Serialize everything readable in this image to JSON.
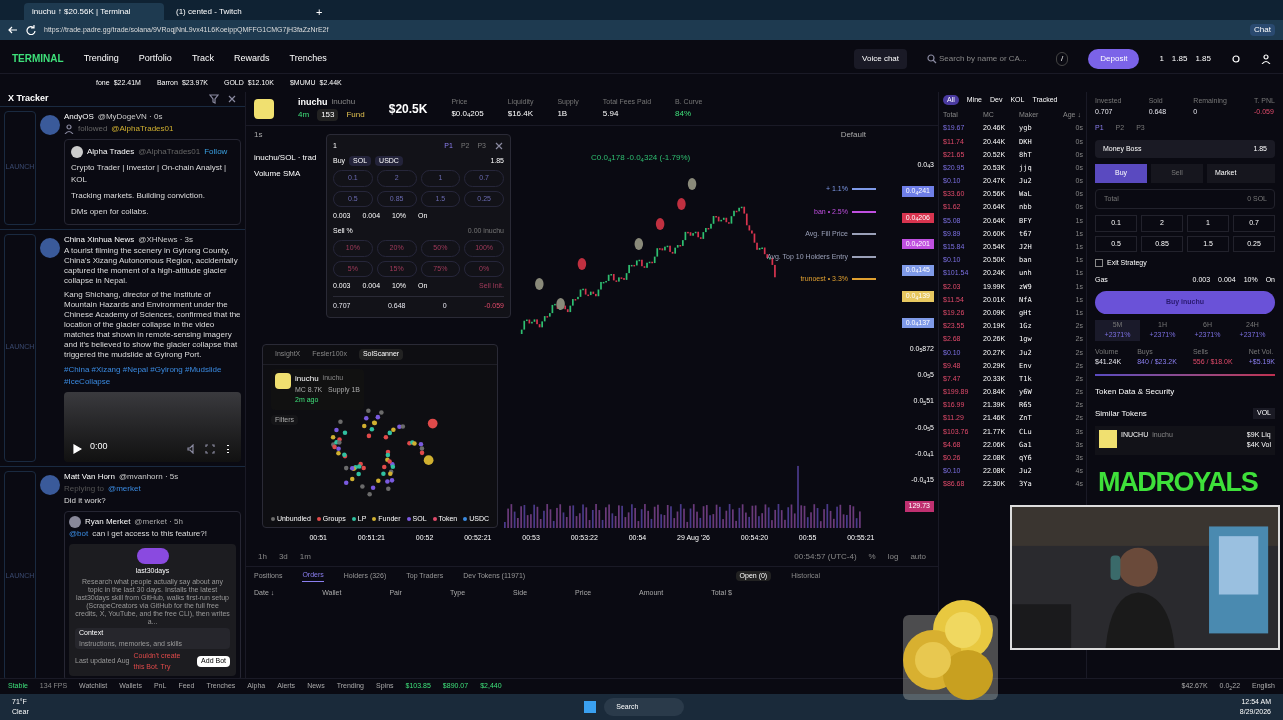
{
  "browser": {
    "tabs": [
      {
        "title": "inuchu ↑ $20.56K | Terminal",
        "selected": true
      },
      {
        "title": "(1) cented - Twitch",
        "selected": false
      }
    ],
    "new_tab": "+",
    "url": "https://trade.padre.gg/trade/solana/9VRoqjNnL9vx41L6KoeippQMFFG1CMG7jH3faZzNrE2f",
    "profile_label": "Chat"
  },
  "nav": {
    "logo": "TERMINAL",
    "items": [
      "Trending",
      "Portfolio",
      "Track",
      "Rewards",
      "Trenches"
    ],
    "voice_chat": "Voice chat",
    "search": {
      "placeholder": "Search by name or CA...",
      "shortcut": "/"
    },
    "deposit": "Deposit",
    "wallet_count": "1",
    "balance_1": "1.85",
    "balance_2": "1.85"
  },
  "ticker": [
    {
      "name": "fone",
      "value": "$22.41M"
    },
    {
      "name": "Barron",
      "value": "$23.97K"
    },
    {
      "name": "GOLD",
      "value": "$12.10K"
    },
    {
      "name": "$MUMU",
      "value": "$2.44K"
    }
  ],
  "tracker": {
    "title": "X Tracker",
    "tweets": [
      {
        "kind": "follow",
        "launch": "LAUNCH",
        "name": "AndyOS",
        "handle": "@MyDogeVN · 0s",
        "action": "followed",
        "target": "@AlphaTrades01",
        "quote": {
          "name": "Alpha Trades",
          "handle": "@AlphaTrades01",
          "follow": "Follow",
          "lines": [
            "Crypto Trader | Investor | On-chain Analyst | KOL",
            "Tracking markets. Building conviction.",
            "DMs open for collabs."
          ]
        }
      },
      {
        "kind": "post",
        "launch": "LAUNCH",
        "name": "China Xinhua News",
        "handle": "@XHNews · 3s",
        "paragraphs": [
          "A tourist filming the scenery in Gyirong County, China's Xizang Autonomous Region, accidentally captured the moment of a high-altitude glacier collapse in Nepal.",
          "Kang Shichang, director of the Institute of Mountain Hazards and Environment under the Chinese Academy of Sciences, confirmed that the location of the glacier collapse in the video matches that shown in remote-sensing imagery and it's believed to show the glacier collapse that triggered the mudslide at Gyirong Port."
        ],
        "hashtags": "#China #Xizang #Nepal #Gyirong #Mudslide #IceCollapse",
        "video_time": "0:00"
      },
      {
        "kind": "reply",
        "launch": "LAUNCH",
        "name": "Matt Van Horn",
        "handle": "@mvanhorn · 5s",
        "replying": "Replying to",
        "reply_to": "@merket",
        "text": "Did it work?",
        "quote": {
          "name": "Ryan Merket",
          "handle": "@merket · 5h",
          "mention": "@bot",
          "text": "can i get access to this feature?!",
          "card": {
            "title": "last30days",
            "description": "Research what people actually say about any topic in the last 30 days. Installs the latest last30days skill from GitHub, walks first-run setup (ScrapeCreators via GitHub for the full free credits, X, YouTube, and the free CLI), then writes a...",
            "section": "Context",
            "section_sub": "Instructions, memories, and skills",
            "updated": "Last updated Aug",
            "error": "Couldn't create this Bot. Try",
            "button": "Add Bot"
          }
        }
      }
    ]
  },
  "token": {
    "name": "inuchu",
    "symbol": "inuchu",
    "age": "4m",
    "watchers": "153",
    "fund": "Fund",
    "mcap": "$20.5K",
    "stats": [
      {
        "label": "Price",
        "value": "$0.0$_{4}$205"
      },
      {
        "label": "Liquidity",
        "value": "$16.4K"
      },
      {
        "label": "Supply",
        "value": "1B"
      },
      {
        "label": "Total Fees Paid",
        "value": "5.94"
      },
      {
        "label": "B. Curve",
        "value": "84%"
      }
    ]
  },
  "chart": {
    "interval": "1s",
    "template": "Default",
    "pair": "inuchu/SOL · trad",
    "indicator": "Volume SMA",
    "ohlc": "C0.0$_{4}$178 -0.0$_{4}$324 (-1.79%)",
    "price_top": "0.0$_{4}$3",
    "badges": [
      {
        "text": "0.0$_{4}$241",
        "color": "#6f7fe8"
      },
      {
        "text": "0.0$_{4}$206",
        "color": "#d8344f"
      },
      {
        "text": "0.0$_{4}$201",
        "color": "#c04fe0"
      },
      {
        "text": "0.0$_{4}$145",
        "color": "#7f9ae8"
      },
      {
        "text": "0.0$_{4}$139",
        "color": "#e8c860"
      },
      {
        "text": "0.0$_{4}$137",
        "color": "#7f9ae8"
      }
    ],
    "price_labels": [
      "0.0$_{5}$872",
      "0.0$_{5}$5",
      "0.0$_{5}$51",
      "-0.0$_{5}$5",
      "-0.0$_{4}$1",
      "-0.0$_{4}$15"
    ],
    "lines": [
      {
        "text": "+ 1.1%",
        "color": "#7f9ae8"
      },
      {
        "text": "ban • 2.5%",
        "color": "#c04fe0"
      },
      {
        "text": "Avg. Fill Price",
        "color": "#9aa0b8"
      },
      {
        "text": "Avg. Top 10 Holders Entry",
        "color": "#9aa0b8"
      },
      {
        "text": "trunoest • 3.3%",
        "color": "#e0a030"
      }
    ],
    "volume_label": "129.73",
    "time_labels": [
      "00:51",
      "00:51:21",
      "00:52",
      "00:52:21",
      "00:53",
      "00:53:22",
      "00:54",
      "29 Aug '26",
      "00:54:20",
      "00:55",
      "00:55:21"
    ],
    "ranges": [
      "1h",
      "3d",
      "1m"
    ],
    "clock": "00:54:57 (UTC-4)",
    "scale_options": [
      "%",
      "log",
      "auto"
    ]
  },
  "quick_trade": {
    "count": "1",
    "presets": [
      {
        "label": "P1",
        "selected": true
      },
      {
        "label": "P2",
        "selected": false
      },
      {
        "label": "P3",
        "selected": false
      }
    ],
    "buy_label": "Buy",
    "currencies": [
      "SOL",
      "USDC"
    ],
    "balance": "1.85",
    "buy_amounts": [
      "0.1",
      "2",
      "1",
      "0.7",
      "0.5",
      "0.85",
      "1.5",
      "0.25"
    ],
    "settings": [
      "0.003",
      "0.004",
      "10%",
      "On"
    ],
    "sell_label": "Sell %",
    "sell_balance": "0.00 inuchu",
    "sell_amounts": [
      "10%",
      "20%",
      "50%",
      "100%",
      "5%",
      "15%",
      "75%",
      "0%"
    ],
    "sell_settings": [
      "0.003",
      "0.004",
      "10%",
      "On"
    ],
    "sell_init": "Sell Init.",
    "summary": [
      {
        "value": "0.707",
        "kind": "neutral"
      },
      {
        "value": "0.648",
        "kind": "neutral"
      },
      {
        "value": "0",
        "kind": "neutral"
      },
      {
        "value": "-0.059",
        "kind": "loss"
      }
    ]
  },
  "scanner": {
    "tabs": [
      {
        "label": "InsightX",
        "selected": false
      },
      {
        "label": "Fesler100x",
        "selected": false
      },
      {
        "label": "SolScanner",
        "selected": true
      }
    ],
    "name": "inuchu",
    "symbol": "inuchu",
    "stats": "MC 8.7K   Supply 1B",
    "age": "2m ago",
    "filters": "Filters",
    "legend": [
      {
        "label": "Unbundled",
        "color": "#6b6b6b"
      },
      {
        "label": "Groups",
        "color": "#e04a4a"
      },
      {
        "label": "LP",
        "color": "#30c0a0"
      },
      {
        "label": "Funder",
        "color": "#d0b030"
      },
      {
        "label": "SOL",
        "color": "#7a5ae0"
      },
      {
        "label": "Token",
        "color": "#e04a6a"
      },
      {
        "label": "USDC",
        "color": "#3a8ae0"
      }
    ]
  },
  "orders": {
    "tabs": [
      {
        "label": "Positions",
        "selected": false
      },
      {
        "label": "Orders",
        "selected": true
      },
      {
        "label": "Holders (326)",
        "selected": false
      },
      {
        "label": "Top Traders",
        "selected": false
      },
      {
        "label": "Dev Tokens (11971)",
        "selected": false
      }
    ],
    "filters": [
      {
        "label": "Open (0)",
        "selected": true
      },
      {
        "label": "Historical",
        "selected": false
      }
    ],
    "columns": [
      "Date ↓",
      "Wallet",
      "Pair",
      "Type",
      "Side",
      "Price",
      "Amount",
      "Total $"
    ]
  },
  "trades": {
    "tabs": [
      {
        "label": "All",
        "selected": true
      },
      {
        "label": "Mine",
        "selected": false
      },
      {
        "label": "Dev",
        "selected": false
      },
      {
        "label": "KOL",
        "selected": false
      },
      {
        "label": "Tracked",
        "selected": false
      }
    ],
    "columns": [
      "Total",
      "MC",
      "Maker",
      "Age ↓"
    ],
    "rows": [
      {
        "total": "$19.67",
        "kind": "buy",
        "mc": "20.46K",
        "maker": "ygb",
        "age": "0s"
      },
      {
        "total": "$11.74",
        "kind": "sell",
        "mc": "20.44K",
        "maker": "DKH",
        "age": "0s"
      },
      {
        "total": "$21.65",
        "kind": "sell",
        "mc": "20.52K",
        "maker": "8hT",
        "age": "0s"
      },
      {
        "total": "$20.95",
        "kind": "buy",
        "mc": "20.53K",
        "maker": "jjq",
        "age": "0s"
      },
      {
        "total": "$0.10",
        "kind": "buy",
        "mc": "20.47K",
        "maker": "Ju2",
        "age": "0s"
      },
      {
        "total": "$33.60",
        "kind": "sell",
        "mc": "20.56K",
        "maker": "WaL",
        "age": "0s"
      },
      {
        "total": "$1.62",
        "kind": "sell",
        "mc": "20.64K",
        "maker": "nbb",
        "age": "0s"
      },
      {
        "total": "$5.08",
        "kind": "buy",
        "mc": "20.64K",
        "maker": "BFY",
        "age": "1s"
      },
      {
        "total": "$9.89",
        "kind": "buy",
        "mc": "20.60K",
        "maker": "t67",
        "age": "1s"
      },
      {
        "total": "$15.84",
        "kind": "buy",
        "mc": "20.54K",
        "maker": "J2H",
        "age": "1s"
      },
      {
        "total": "$0.10",
        "kind": "buy",
        "mc": "20.50K",
        "maker": "ban",
        "age": "1s"
      },
      {
        "total": "$101.54",
        "kind": "buy",
        "mc": "20.24K",
        "maker": "unh",
        "age": "1s"
      },
      {
        "total": "$2.03",
        "kind": "sell",
        "mc": "19.99K",
        "maker": "zW9",
        "age": "1s"
      },
      {
        "total": "$11.54",
        "kind": "sell",
        "mc": "20.01K",
        "maker": "NfA",
        "age": "1s"
      },
      {
        "total": "$19.26",
        "kind": "sell",
        "mc": "20.09K",
        "maker": "gHt",
        "age": "1s"
      },
      {
        "total": "$23.55",
        "kind": "sell",
        "mc": "20.19K",
        "maker": "1Gz",
        "age": "2s"
      },
      {
        "total": "$2.68",
        "kind": "sell",
        "mc": "20.26K",
        "maker": "1gw",
        "age": "2s"
      },
      {
        "total": "$0.10",
        "kind": "buy",
        "mc": "20.27K",
        "maker": "Ju2",
        "age": "2s"
      },
      {
        "total": "$9.48",
        "kind": "sell",
        "mc": "20.29K",
        "maker": "Env",
        "age": "2s"
      },
      {
        "total": "$7.47",
        "kind": "sell",
        "mc": "20.33K",
        "maker": "T1k",
        "age": "2s"
      },
      {
        "total": "$199.89",
        "kind": "sell",
        "mc": "20.84K",
        "maker": "y6W",
        "age": "2s"
      },
      {
        "total": "$16.99",
        "kind": "sell",
        "mc": "21.39K",
        "maker": "R65",
        "age": "2s"
      },
      {
        "total": "$11.29",
        "kind": "sell",
        "mc": "21.46K",
        "maker": "ZnT",
        "age": "2s"
      },
      {
        "total": "$103.76",
        "kind": "sell",
        "mc": "21.77K",
        "maker": "CLu",
        "age": "3s"
      },
      {
        "total": "$4.68",
        "kind": "sell",
        "mc": "22.06K",
        "maker": "Ga1",
        "age": "3s"
      },
      {
        "total": "$0.26",
        "kind": "sell",
        "mc": "22.08K",
        "maker": "qY6",
        "age": "3s"
      },
      {
        "total": "$0.10",
        "kind": "buy",
        "mc": "22.08K",
        "maker": "Ju2",
        "age": "4s"
      },
      {
        "total": "$86.68",
        "kind": "sell",
        "mc": "22.30K",
        "maker": "3Ya",
        "age": "4s"
      }
    ]
  },
  "position": {
    "stats": [
      {
        "label": "Invested",
        "value": "0.707",
        "kind": "neutral"
      },
      {
        "label": "Sold",
        "value": "0.648",
        "kind": "neutral"
      },
      {
        "label": "Remaining",
        "value": "0",
        "kind": "neutral"
      },
      {
        "label": "T. PNL",
        "value": "-0.059",
        "kind": "loss"
      }
    ],
    "presets": [
      {
        "label": "P1",
        "selected": true
      },
      {
        "label": "P2",
        "selected": false
      },
      {
        "label": "P3",
        "selected": false
      }
    ],
    "wallet": "Money Boss",
    "wallet_balance": "1.85",
    "modes": [
      {
        "label": "Buy",
        "selected": true
      },
      {
        "label": "Sell",
        "selected": false
      }
    ],
    "order_type": "Market",
    "total_placeholder": "Total",
    "total_unit": "0 SOL",
    "amounts": [
      "0.1",
      "2",
      "1",
      "0.7",
      "0.5",
      "0.85",
      "1.5",
      "0.25"
    ],
    "exit_strategy": {
      "label": "Exit Strategy",
      "checked": false
    },
    "gas_label": "Gas",
    "gas": [
      "0.003",
      "0.004",
      "10%",
      "On"
    ],
    "buy_button": "Buy inuchu",
    "periods": [
      {
        "label": "5M",
        "change": "+2371%",
        "selected": true
      },
      {
        "label": "1H",
        "change": "+2371%",
        "selected": false
      },
      {
        "label": "6H",
        "change": "+2371%",
        "selected": false
      },
      {
        "label": "24H",
        "change": "+2371%",
        "selected": false
      }
    ],
    "flow": [
      {
        "label": "Volume",
        "value": "$41.24K",
        "kind": "neutral"
      },
      {
        "label": "Buys",
        "value": "840 / $23.2K",
        "kind": "buy"
      },
      {
        "label": "Sells",
        "value": "556 / $18.0K",
        "kind": "sell"
      },
      {
        "label": "Net Vol.",
        "value": "+$5.19K",
        "kind": "buy"
      }
    ],
    "security": "Token Data & Security",
    "similar": "Similar Tokens",
    "similar_sort": "VOL",
    "similar_token": {
      "name": "INUCHU",
      "symbol": "inuchu",
      "liq": "$9K Liq",
      "vol": "$4K Vol"
    }
  },
  "overlay_text": "MADROYALS",
  "status": {
    "connection": "Stable",
    "fps": "134 FPS",
    "items": [
      "Watchlist",
      "Wallets",
      "PnL",
      "Feed",
      "Trenches",
      "Alpha",
      "Alerts",
      "News",
      "Trending",
      "Spins"
    ],
    "prices": [
      "$103.85",
      "$890.07",
      "$2,440"
    ],
    "right": [
      "$42.67K",
      "0.0$_{2}$22",
      "English"
    ]
  },
  "taskbar": {
    "temp": "71°F",
    "weather": "Clear",
    "search": "Search",
    "time": "12:54 AM",
    "date": "8/29/2026"
  }
}
